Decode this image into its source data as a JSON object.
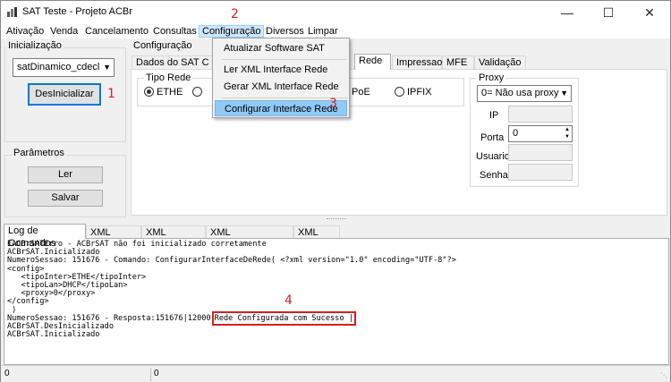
{
  "window": {
    "title": "SAT Teste - Projeto ACBr",
    "icon": "sat-app-icon"
  },
  "window_controls": {
    "minimize": "—",
    "maximize": "☐",
    "close": "✕"
  },
  "menubar": {
    "items": [
      "Ativação",
      "Venda",
      "Cancelamento",
      "Consultas",
      "Configuração",
      "Diversos",
      "Limpar"
    ]
  },
  "configuracao_menu": {
    "items": [
      "Atualizar Software SAT",
      "Ler XML Interface Rede",
      "Gerar XML Interface Rede",
      "Configurar Interface Rede"
    ],
    "highlighted": "Configurar Interface Rede"
  },
  "annotations": [
    "1",
    "2",
    "3",
    "4"
  ],
  "inicializacao": {
    "group_label": "Inicialização",
    "model_value": "satDinamico_cdecl",
    "button_label": "DesInicializar"
  },
  "parametros": {
    "group_label": "Parâmetros",
    "read_label": "Ler",
    "save_label": "Salvar"
  },
  "configuracao_panel": {
    "group_label": "Configuração",
    "tabs": [
      "Dados do SAT C",
      "Rede",
      "Impressao",
      "MFE",
      "Validação"
    ],
    "selected_tab": "Rede",
    "tipo_rede": {
      "label": "Tipo Rede",
      "options": [
        "ETHE",
        "PoE",
        "IPFIX"
      ],
      "selected": "ETHE"
    },
    "proxy": {
      "label": "Proxy",
      "value": "0= Não usa proxy",
      "ip_label": "IP",
      "porta_label": "Porta",
      "porta_value": "0",
      "usuario_label": "Usuario",
      "senha_label": "Senha"
    }
  },
  "log_tabs": [
    "Log de Comandos",
    "XML Gerado",
    "XML Recebido",
    "XML Cancelamento",
    "XML Rede"
  ],
  "log_selected_tab": "Log de Comandos",
  "log": {
    "line_1": "EACBrSATErro - ACBrSAT não foi inicializado corretamente",
    "line_2": "ACBrSAT.Inicializado",
    "line_3": "NumeroSessao: 151676 - Comando: ConfigurarInterfaceDeRede( <?xml version=\"1.0\" encoding=\"UTF-8\"?>",
    "line_4": "<config>",
    "line_5": "   <tipoInter>ETHE</tipoInter>",
    "line_6": "   <tipoLan>DHCP</tipoLan>",
    "line_7": "   <proxy>0</proxy>",
    "line_8": "</config>",
    "line_9": " )",
    "line_10a": "NumeroSessao: 151676 - Resposta:151676|12000",
    "line_10b": "Rede Configurada com Sucesso |",
    "line_11": "ACBrSAT.DesInicializado",
    "line_12": "ACBrSAT.Inicializado"
  },
  "statusbar": {
    "left": "0",
    "right": "0"
  },
  "colors": {
    "annotation": "#d91f1f",
    "menu_highlight": "#91c9f7",
    "accent": "#0078d7"
  }
}
